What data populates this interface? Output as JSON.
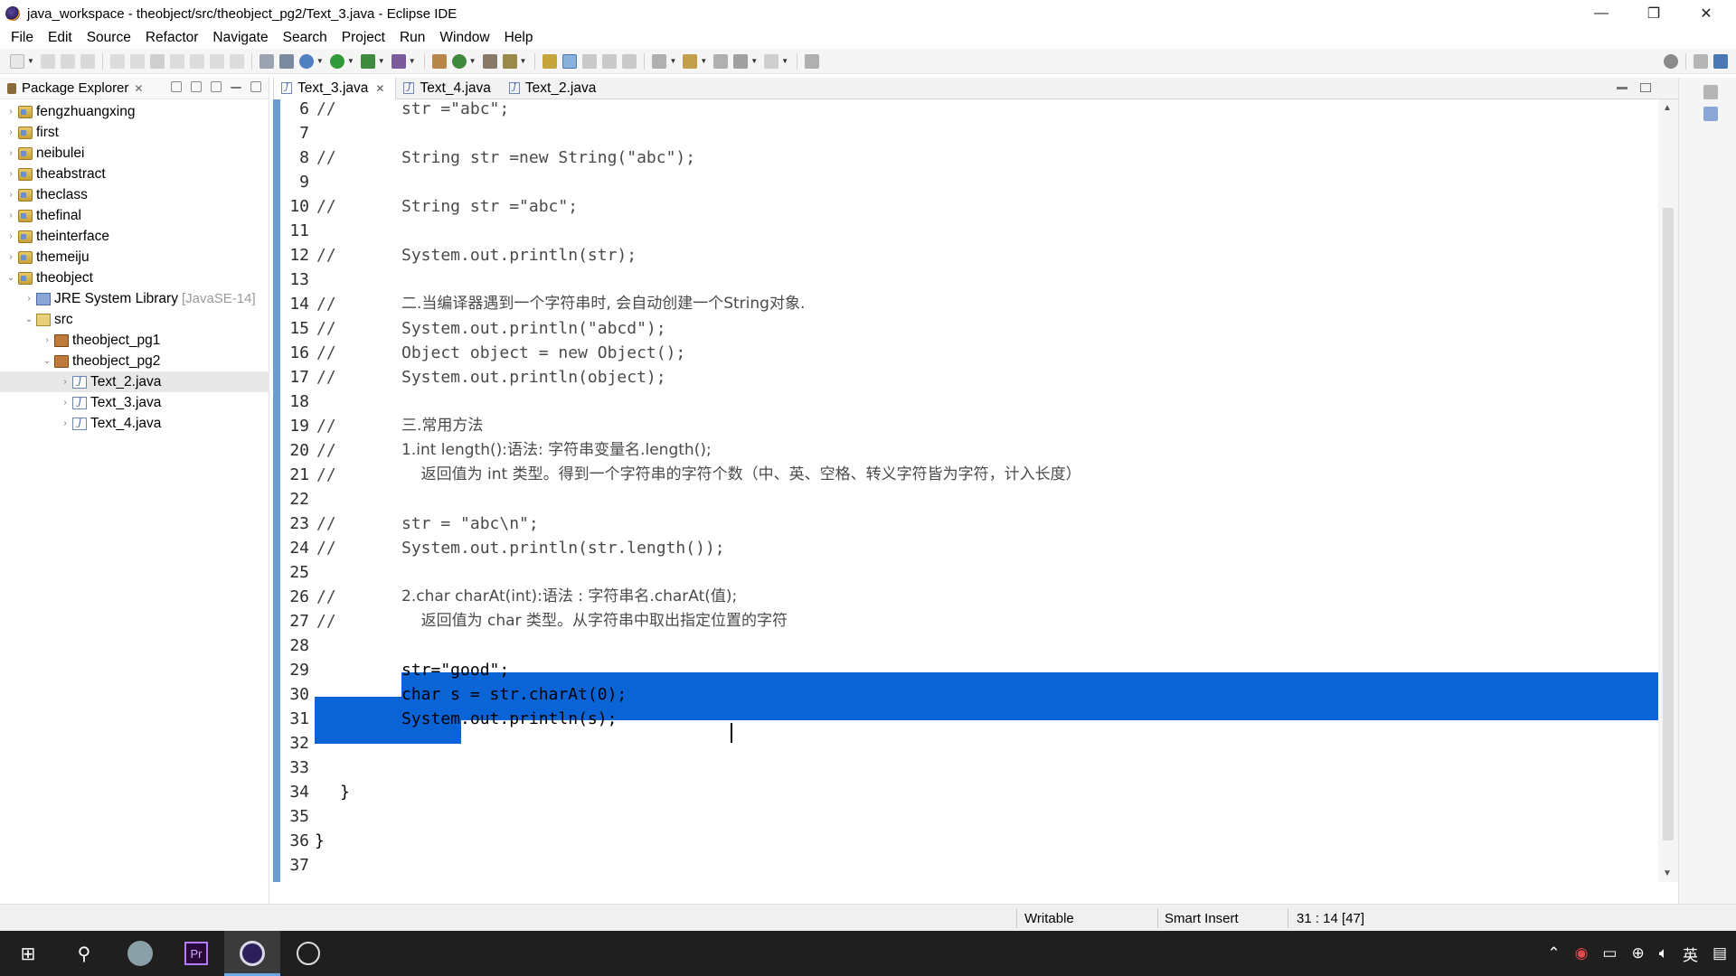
{
  "window": {
    "title": "java_workspace - theobject/src/theobject_pg2/Text_3.java - Eclipse IDE",
    "minimize": "—",
    "restore": "❐",
    "close": "✕"
  },
  "menu": [
    "File",
    "Edit",
    "Source",
    "Refactor",
    "Navigate",
    "Search",
    "Project",
    "Run",
    "Window",
    "Help"
  ],
  "package_explorer": {
    "title": "Package Explorer",
    "projects": [
      {
        "label": "fengzhuangxing"
      },
      {
        "label": "first"
      },
      {
        "label": "neibulei"
      },
      {
        "label": "theabstract"
      },
      {
        "label": "theclass"
      },
      {
        "label": "thefinal"
      },
      {
        "label": "theinterface"
      },
      {
        "label": "themeiju"
      },
      {
        "label": "theobject"
      }
    ],
    "jre": {
      "label": "JRE System Library",
      "decoration": "[JavaSE-14]"
    },
    "src": "src",
    "packages": [
      "theobject_pg1",
      "theobject_pg2"
    ],
    "files": [
      "Text_2.java",
      "Text_3.java",
      "Text_4.java"
    ]
  },
  "editor": {
    "tabs": [
      {
        "label": "Text_3.java",
        "active": true
      },
      {
        "label": "Text_4.java",
        "active": false
      },
      {
        "label": "Text_2.java",
        "active": false
      }
    ],
    "lines": [
      {
        "n": "6",
        "c": "//",
        "code": "str =\"abc\";"
      },
      {
        "n": "7",
        "c": "",
        "code": ""
      },
      {
        "n": "8",
        "c": "//",
        "code": "String str =new String(\"abc\");"
      },
      {
        "n": "9",
        "c": "",
        "code": ""
      },
      {
        "n": "10",
        "c": "//",
        "code": "String str =\"abc\";"
      },
      {
        "n": "11",
        "c": "",
        "code": ""
      },
      {
        "n": "12",
        "c": "//",
        "code": "System.out.println(str);"
      },
      {
        "n": "13",
        "c": "",
        "code": ""
      },
      {
        "n": "14",
        "c": "//",
        "code": "二.当编译器遇到一个字符串时, 会自动创建一个String对象."
      },
      {
        "n": "15",
        "c": "//",
        "code": "System.out.println(\"abcd\");"
      },
      {
        "n": "16",
        "c": "//",
        "code": "Object object = new Object();"
      },
      {
        "n": "17",
        "c": "//",
        "code": "System.out.println(object);"
      },
      {
        "n": "18",
        "c": "",
        "code": ""
      },
      {
        "n": "19",
        "c": "//",
        "code": "三.常用方法"
      },
      {
        "n": "20",
        "c": "//",
        "code": "1.int length():语法: 字符串变量名.length();"
      },
      {
        "n": "21",
        "c": "//",
        "code": "    返回值为 int 类型。得到一个字符串的字符个数（中、英、空格、转义字符皆为字符，计入长度）"
      },
      {
        "n": "22",
        "c": "",
        "code": ""
      },
      {
        "n": "23",
        "c": "//",
        "code": "str = \"abc\\n\";"
      },
      {
        "n": "24",
        "c": "//",
        "code": "System.out.println(str.length());"
      },
      {
        "n": "25",
        "c": "",
        "code": ""
      },
      {
        "n": "26",
        "c": "//",
        "code": "2.char charAt(int):语法 : 字符串名.charAt(值);"
      },
      {
        "n": "27",
        "c": "//",
        "code": "    返回值为 char 类型。从字符串中取出指定位置的字符"
      },
      {
        "n": "28",
        "c": "",
        "code": ""
      },
      {
        "n": "29",
        "c": "",
        "code": "str=\"good\";"
      },
      {
        "n": "30",
        "c": "",
        "code": "char s = str.charAt(0);"
      },
      {
        "n": "31",
        "c": "",
        "code": "System.out.println(s);"
      },
      {
        "n": "32",
        "c": "",
        "code": ""
      },
      {
        "n": "33",
        "c": "",
        "code": ""
      },
      {
        "n": "34",
        "c": "",
        "code": "}"
      },
      {
        "n": "35",
        "c": "",
        "code": ""
      },
      {
        "n": "36",
        "c": "",
        "code": "}"
      },
      {
        "n": "37",
        "c": "",
        "code": ""
      }
    ]
  },
  "statusbar": {
    "writable": "Writable",
    "insert_mode": "Smart Insert",
    "position": "31 : 14 [47]"
  },
  "colors": {
    "selection": "#0a64d6",
    "keyword": "#7f0055",
    "ruler": "#6a9bd1"
  }
}
